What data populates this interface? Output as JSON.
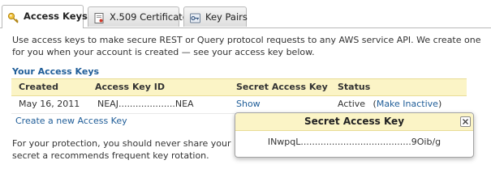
{
  "tabs": [
    {
      "label": "Access Keys",
      "icon": "key-icon",
      "active": true
    },
    {
      "label": "X.509 Certificates",
      "icon": "certificate-icon",
      "active": false
    },
    {
      "label": "Key Pairs",
      "icon": "key-pair-icon",
      "active": false
    }
  ],
  "intro_text": "Use access keys to make secure REST or Query protocol requests to any AWS service API. We create one for you when your account is created — see your access key below.",
  "section_title": "Your Access Keys",
  "table": {
    "columns": [
      "Created",
      "Access Key ID",
      "Secret Access Key",
      "Status"
    ],
    "rows": [
      {
        "created": "May 16, 2011",
        "access_key_id": "NEAJ....................NEA",
        "secret_action": "Show",
        "status": "Active",
        "status_action_open": "(",
        "status_action": "Make Inactive",
        "status_action_close": ")"
      }
    ]
  },
  "create_link": "Create a new Access Key",
  "protection_text": "For your protection, you should never share your secret a recommends frequent key rotation.",
  "popup": {
    "title": "Secret Access Key",
    "secret_key": "INwpqL.......................................9Oib/g"
  },
  "colors": {
    "link": "#1f5d98",
    "header_bg": "#fbf4c6",
    "section_title": "#1f5d98"
  }
}
